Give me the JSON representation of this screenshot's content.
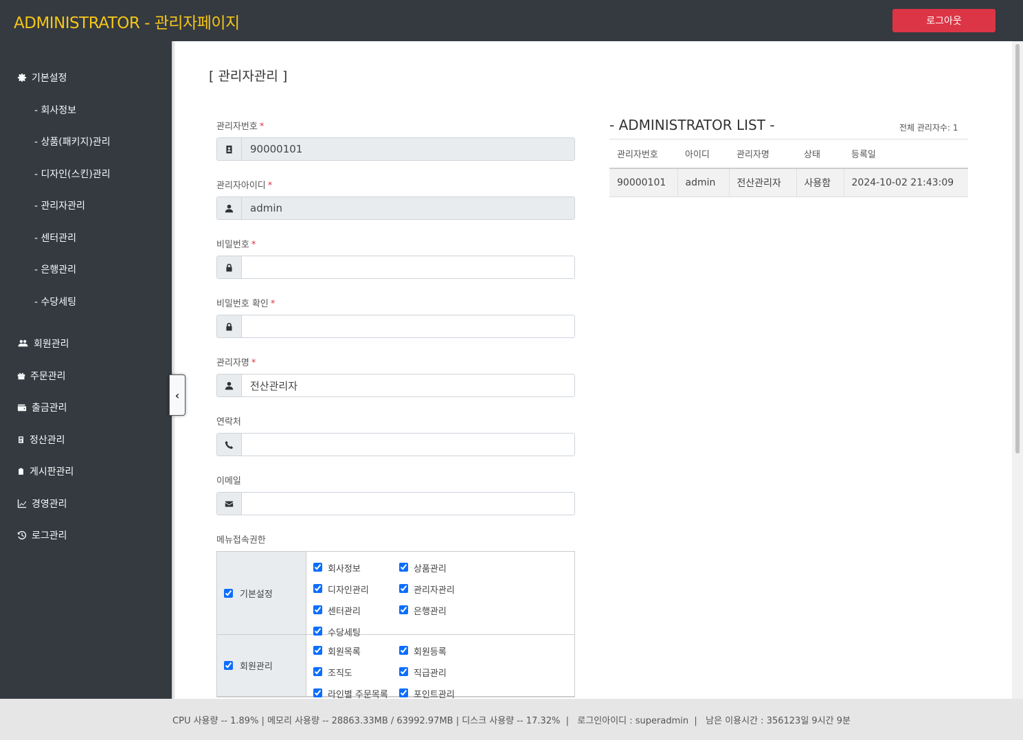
{
  "header": {
    "title": "ADMINISTRATOR - 관리자페이지",
    "logout_label": "로그아웃"
  },
  "sidebar": {
    "sections": [
      {
        "label": "기본설정",
        "icon": "gear-icon"
      },
      {
        "label": "회원관리",
        "icon": "users-icon"
      },
      {
        "label": "주문관리",
        "icon": "gift-icon"
      },
      {
        "label": "출금관리",
        "icon": "wallet-icon"
      },
      {
        "label": "정산관리",
        "icon": "calculator-icon"
      },
      {
        "label": "게시판관리",
        "icon": "clipboard-icon"
      },
      {
        "label": "경영관리",
        "icon": "chart-line-icon"
      },
      {
        "label": "로그관리",
        "icon": "history-icon"
      }
    ],
    "sub_items": [
      "- 회사정보",
      "- 상품(패키지)관리",
      "- 디자인(스킨)관리",
      "- 관리자관리",
      "- 센터관리",
      "- 은행관리",
      "- 수당세팅"
    ]
  },
  "page": {
    "title": "[ 관리자관리 ]"
  },
  "form": {
    "admin_no": {
      "label": "관리자번호",
      "value": "90000101"
    },
    "admin_id": {
      "label": "관리자아이디",
      "value": "admin"
    },
    "password": {
      "label": "비밀번호",
      "value": ""
    },
    "password_confirm": {
      "label": "비밀번호 확인",
      "value": ""
    },
    "admin_name": {
      "label": "관리자명",
      "value": "전산관리자"
    },
    "contact": {
      "label": "연락처",
      "value": ""
    },
    "email": {
      "label": "이메일",
      "value": ""
    },
    "required_mark": "*",
    "permissions_label": "메뉴접속권한",
    "permissions": [
      {
        "group": "기본설정",
        "checked": true,
        "items": [
          "회사정보",
          "상품관리",
          "디자인관리",
          "관리자관리",
          "센터관리",
          "은행관리",
          "수당세팅"
        ]
      },
      {
        "group": "회원관리",
        "checked": true,
        "items": [
          "회원목록",
          "회원등록",
          "조직도",
          "직급관리",
          "라인별 주문목록",
          "포인트관리"
        ]
      }
    ]
  },
  "list": {
    "title": "- ADMINISTRATOR LIST -",
    "count_text": "전체 관리자수: 1",
    "columns": [
      "관리자번호",
      "아이디",
      "관리자명",
      "상태",
      "등록일"
    ],
    "rows": [
      [
        "90000101",
        "admin",
        "전산관리자",
        "사용함",
        "2024-10-02 21:43:09"
      ]
    ]
  },
  "footer": {
    "status": "CPU 사용량 -- 1.89% | 메모리 사용량 -- 28863.33MB / 63992.97MB | 디스크 사용량 -- 17.32%  |   로그인아이디 : superadmin  |   남은 이용시간 : 356123일 9시간 9분"
  },
  "colors": {
    "header_bg": "#343a40",
    "title_accent": "#f5c518",
    "logout_bg": "#dc3545",
    "footer_bg": "#e6e6e6"
  }
}
